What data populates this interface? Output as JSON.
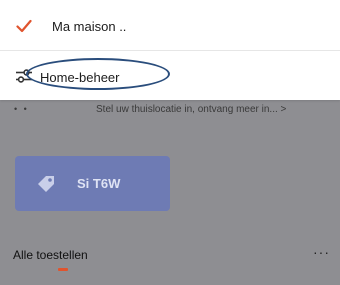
{
  "menu": {
    "items": [
      {
        "label": "Ma maison ..",
        "icon": "check-icon",
        "selected": true,
        "highlighted": false
      },
      {
        "label": "Home-beheer",
        "icon": "sliders-icon",
        "selected": false,
        "highlighted": true
      }
    ]
  },
  "background": {
    "banner_dots": "• •",
    "banner_text": "Stel uw thuislocatie in, ontvang meer in... >",
    "card_label": "Si T6W",
    "card_icon": "tag-icon",
    "section_title": "Alle toestellen",
    "more_label": "···"
  },
  "colors": {
    "accent": "#e0542e",
    "highlight_ring": "#2a4d7c",
    "card": "#6e7bb4",
    "dim_overlay": "#8e8e92"
  }
}
